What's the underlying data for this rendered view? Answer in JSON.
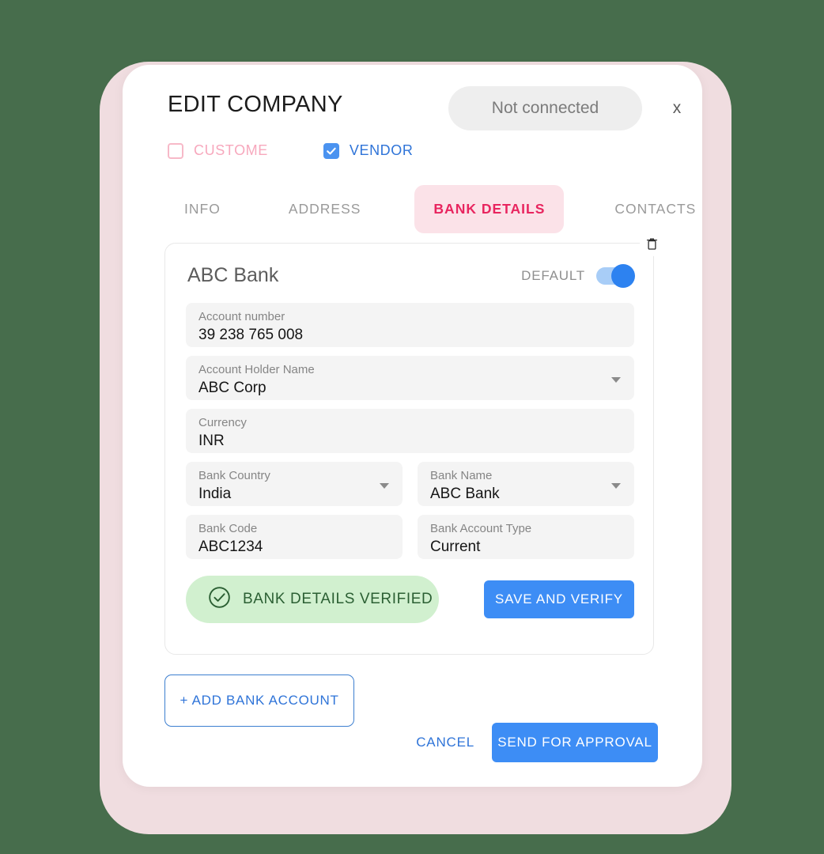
{
  "header": {
    "title": "EDIT COMPANY",
    "status": "Not connected",
    "close_label": "x"
  },
  "roles": [
    {
      "label": "CUSTOME",
      "checked": false,
      "icon": "unchecked-checkbox-icon"
    },
    {
      "label": "VENDOR",
      "checked": true,
      "icon": "checked-checkbox-icon"
    }
  ],
  "tabs": [
    {
      "label": "INFO",
      "active": false
    },
    {
      "label": "ADDRESS",
      "active": false
    },
    {
      "label": "BANK DETAILS",
      "active": true
    },
    {
      "label": "CONTACTS",
      "active": false
    }
  ],
  "bank_card": {
    "name": "ABC Bank",
    "default_label": "DEFAULT",
    "default_on": true,
    "delete_icon": "trash-icon",
    "fields": {
      "account_number": {
        "label": "Account number",
        "value": "39 238 765 008"
      },
      "account_holder": {
        "label": "Account Holder Name",
        "value": "ABC Corp"
      },
      "currency": {
        "label": "Currency",
        "value": "INR"
      },
      "bank_country": {
        "label": "Bank Country",
        "value": "India"
      },
      "bank_name": {
        "label": "Bank Name",
        "value": "ABC Bank"
      },
      "bank_code": {
        "label": "Bank Code",
        "value": "ABC1234"
      },
      "account_type": {
        "label": "Bank Account Type",
        "value": "Current"
      }
    },
    "verified_label": "BANK DETAILS VERIFIED",
    "verified_icon": "check-circle-icon",
    "save_verify_label": "SAVE AND VERIFY"
  },
  "footer": {
    "add_account_label": "+ ADD BANK ACCOUNT",
    "cancel_label": "CANCEL",
    "send_approval_label": "SEND FOR APPROVAL"
  },
  "colors": {
    "background": "#476d4c",
    "frame": "#f0dde0",
    "accent_blue": "#3d8df5",
    "accent_pink": "#e8255f",
    "tab_active_bg": "#fbe2e8",
    "verified_bg": "#d1f0cf",
    "verified_text": "#2b5f33",
    "field_bg": "#f4f4f4"
  }
}
